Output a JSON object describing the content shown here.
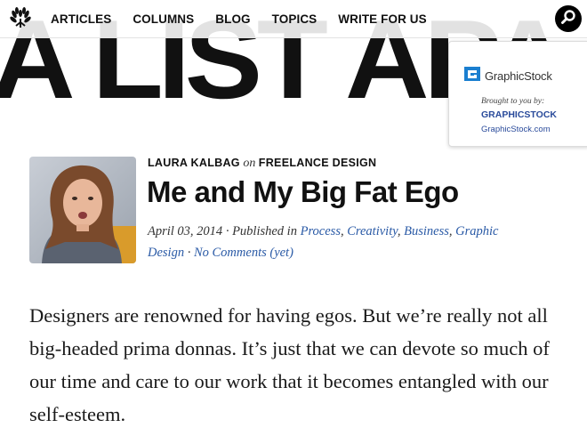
{
  "header": {
    "wordmark": "A LIST APA",
    "nav": [
      "ARTICLES",
      "COLUMNS",
      "BLOG",
      "TOPICS",
      "WRITE FOR US"
    ]
  },
  "sponsor": {
    "logo_text": "GraphicStock",
    "brought_by": "Brought to you by:",
    "name": "GRAPHICSTOCK",
    "url": "GraphicStock.com"
  },
  "article": {
    "author": "LAURA KALBAG",
    "on": "on",
    "category": "FREELANCE DESIGN",
    "title": "Me and My Big Fat Ego",
    "date": "April 03, 2014",
    "published_in": "Published in",
    "topics": [
      "Process",
      "Creativity",
      "Business",
      "Graphic Design"
    ],
    "comments": "No Comments (yet)",
    "body": "Designers are renowned for having egos. But we’re really not all big-headed prima donnas. It’s just that we can devote so much of our time and care to our work that it becomes entangled with our self-esteem."
  },
  "colors": {
    "link": "#2a5aa6",
    "sponsor_link": "#2a4b9b",
    "text": "#111111"
  },
  "icons": {
    "logo": "laurel-logo-icon",
    "search": "search-icon",
    "sponsor_logo": "graphicstock-logo-icon"
  }
}
